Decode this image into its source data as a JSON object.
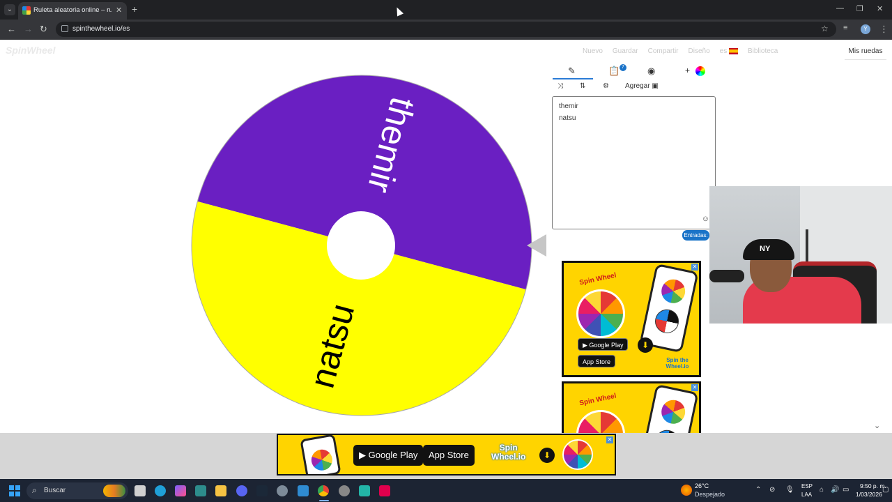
{
  "browser": {
    "tab_title": "Ruleta aleatoria online – ruleta",
    "url": "spinthewheel.io/es",
    "profile_initial": "Y"
  },
  "site": {
    "logo": "SpinWheel",
    "menu": [
      "Nuevo",
      "Guardar",
      "Compartir",
      "Diseño",
      "es",
      "Biblioteca"
    ],
    "my_wheels": "Mis ruedas"
  },
  "wheel": {
    "segments": [
      {
        "label": "themir",
        "color": "#6a1fc2",
        "text_color": "#ffffff"
      },
      {
        "label": "natsu",
        "color": "#ffff00",
        "text_color": "#000000"
      }
    ]
  },
  "editor": {
    "badge_count": "7",
    "add_label": "Agregar",
    "entries": [
      "themir",
      "natsu"
    ],
    "entries_badge": "Entradas:"
  },
  "ads": {
    "title": "Spin Wheel",
    "google_play": "Google Play",
    "app_store": "App Store",
    "brand": "Spin the Wheel.io",
    "banner_brand_line1": "Spin",
    "banner_brand_line2": "Wheel.io"
  },
  "taskbar": {
    "search_label": "Buscar",
    "weather_temp": "26°C",
    "weather_desc": "Despejado",
    "lang1": "ESP",
    "lang2": "LAA",
    "time": "9:50 p. m.",
    "date": "1/03/2026"
  },
  "colors": {
    "accent_blue": "#1a73c8",
    "wheel_purple": "#6a1fc2",
    "wheel_yellow": "#ffff00",
    "ad_yellow": "#ffd400"
  }
}
